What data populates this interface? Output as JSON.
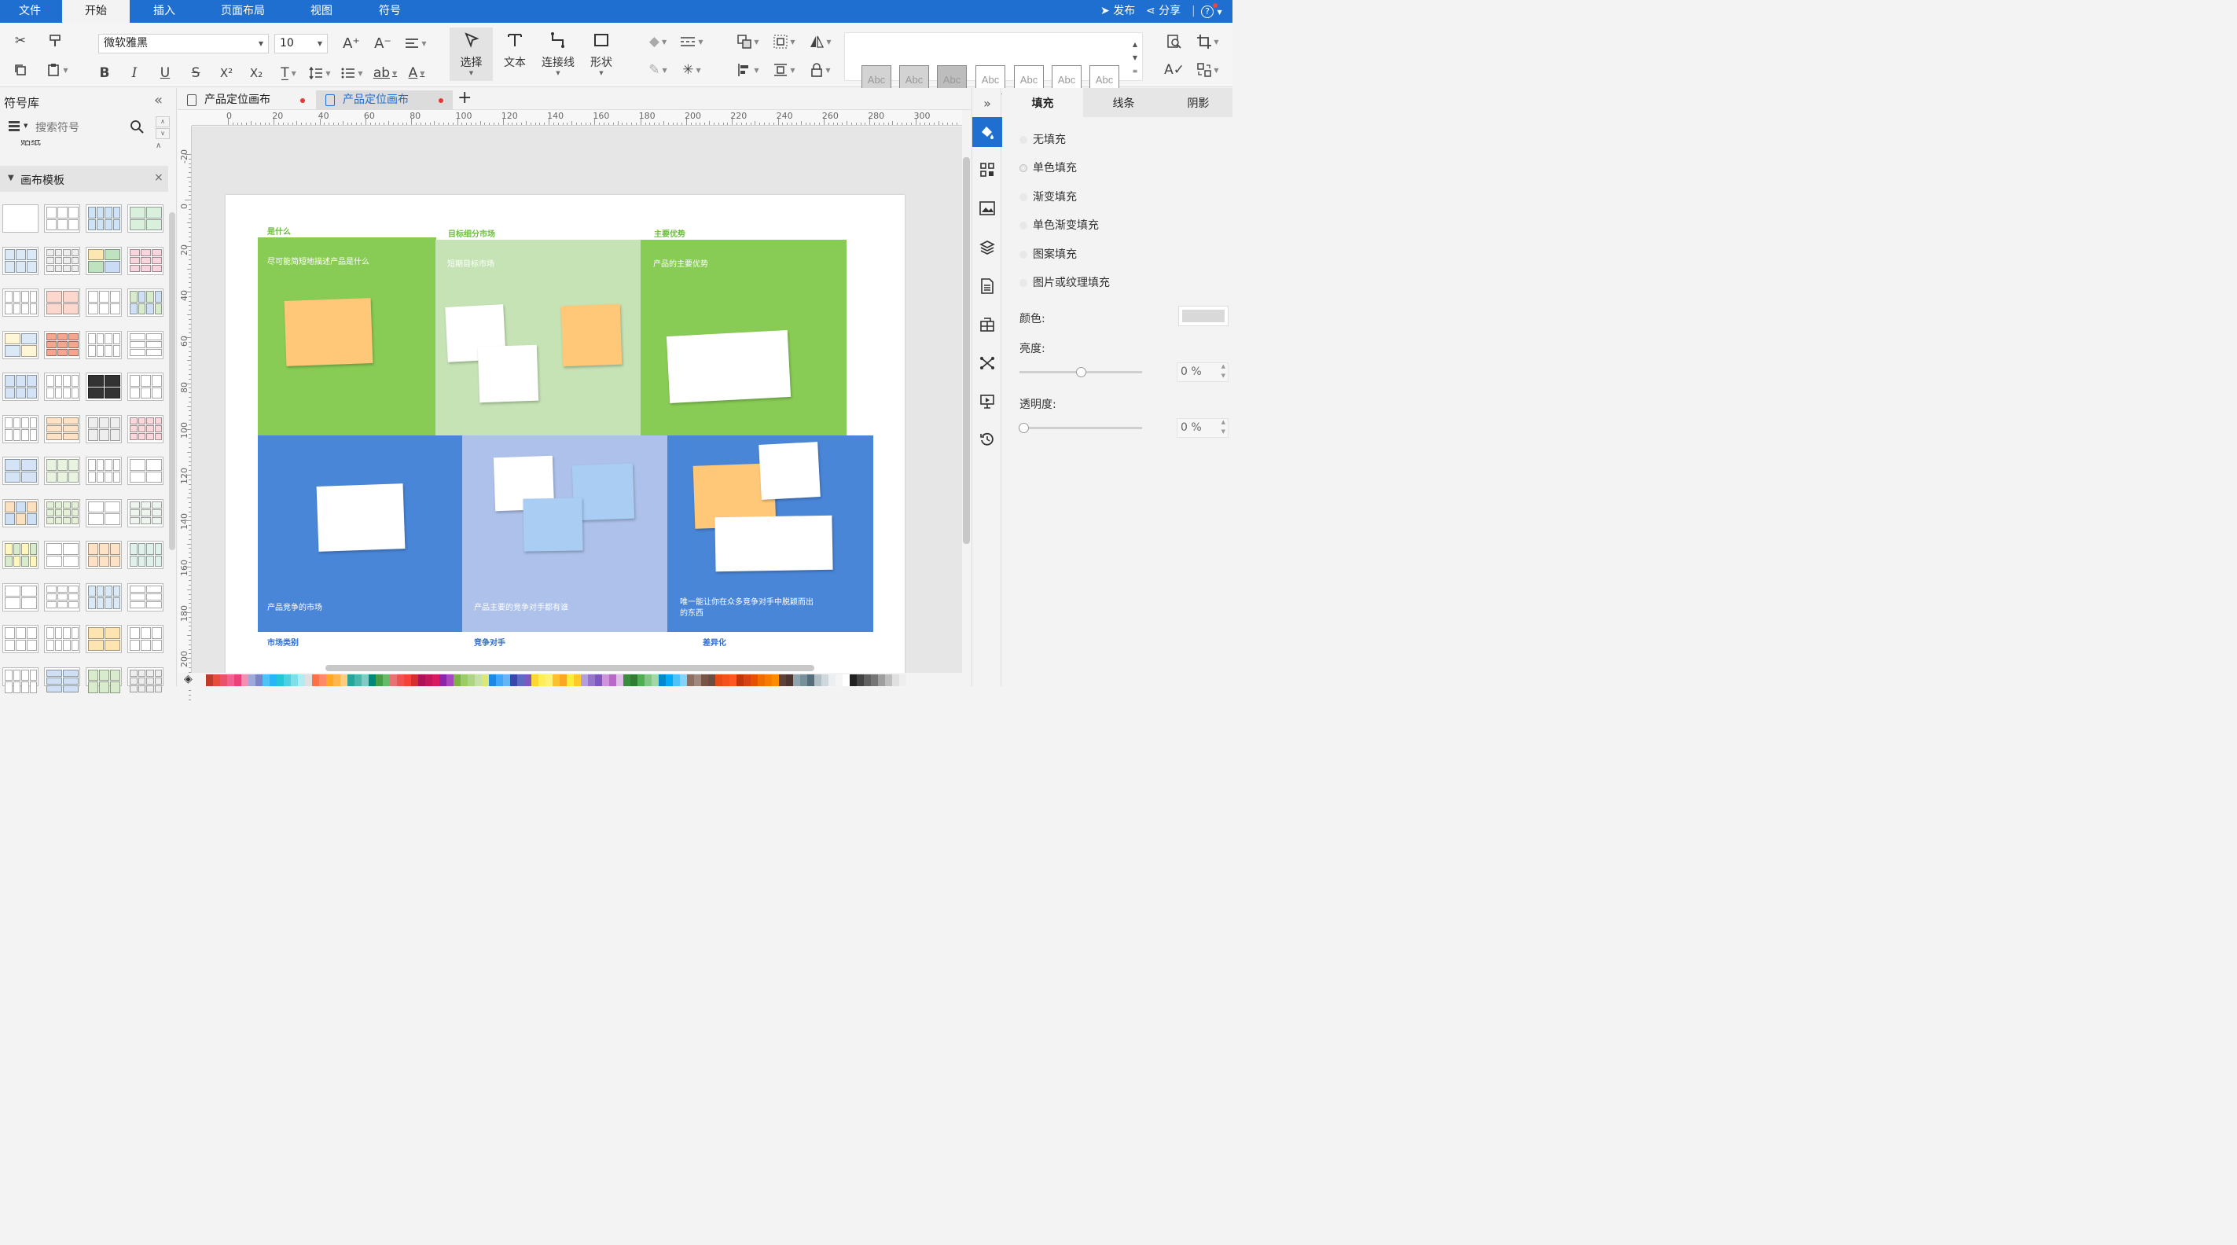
{
  "menu": {
    "tabs": [
      "文件",
      "开始",
      "插入",
      "页面布局",
      "视图",
      "符号"
    ],
    "active": "开始",
    "publish": "发布",
    "share": "分享",
    "help": "?"
  },
  "toolbar": {
    "font_family": "微软雅黑",
    "font_size": "10",
    "tools": [
      "选择",
      "文本",
      "连接线",
      "形状"
    ],
    "style_samples": [
      "Abc",
      "Abc",
      "Abc",
      "Abc",
      "Abc",
      "Abc",
      "Abc"
    ]
  },
  "sidebar": {
    "title": "符号库",
    "search_placeholder": "搜索符号",
    "collapsed_section": "贴纸",
    "section_title": "画布模板"
  },
  "tabs": [
    {
      "label": "产品定位画布",
      "active": false
    },
    {
      "label": "产品定位画布",
      "active": true
    }
  ],
  "ruler": {
    "h_labels": [
      "0",
      "20",
      "40",
      "60",
      "80",
      "100",
      "120",
      "140",
      "160",
      "180",
      "200",
      "220",
      "240",
      "260",
      "280",
      "300"
    ],
    "v_labels": [
      "-20",
      "0",
      "20",
      "40",
      "60",
      "80",
      "100",
      "120",
      "140",
      "160",
      "180",
      "200"
    ]
  },
  "diagram": {
    "titles": {
      "what": "是什么",
      "segment": "目标细分市场",
      "advantage": "主要优势",
      "category": "市场类别",
      "competition": "竞争对手",
      "differentiation": "差异化"
    },
    "descriptions": {
      "what": "尽可能简短地描述产品是什么",
      "segment": "短期目标市场",
      "advantage": "产品的主要优势",
      "category": "产品竞争的市场",
      "competition": "产品主要的竞争对手都有谁",
      "differentiation_1": "唯一能让你在众多竞争对手中脱颖而出",
      "differentiation_2": "的东西"
    },
    "colors": {
      "green": "#88cc55",
      "light_green": "#c5e3b4",
      "blue": "#4a86d8",
      "light_blue": "#adc1eb",
      "orange_note": "#ffc878",
      "blue_note": "#a9cdf3",
      "green_title": "#6cbe3f",
      "blue_title": "#2e6bd0"
    }
  },
  "right_panel": {
    "tabs": [
      "填充",
      "线条",
      "阴影"
    ],
    "active_tab": "填充",
    "fill_options": [
      "无填充",
      "单色填充",
      "渐变填充",
      "单色渐变填充",
      "图案填充",
      "图片或纹理填充"
    ],
    "color_label": "颜色:",
    "brightness_label": "亮度:",
    "brightness_value": "0 %",
    "transparency_label": "透明度:",
    "transparency_value": "0 %"
  }
}
